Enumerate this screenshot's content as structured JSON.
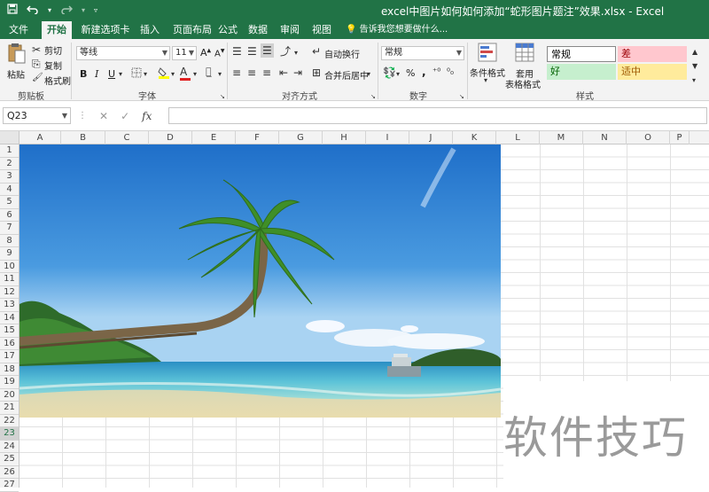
{
  "window": {
    "title": "excel中图片如何如何添加“蛇形图片题注”效果.xlsx - Excel"
  },
  "qat": {
    "save_icon": "save-icon",
    "undo_icon": "undo-icon",
    "redo_icon": "redo-icon"
  },
  "tabs": [
    {
      "label": "文件"
    },
    {
      "label": "开始"
    },
    {
      "label": "新建选项卡"
    },
    {
      "label": "插入"
    },
    {
      "label": "页面布局"
    },
    {
      "label": "公式"
    },
    {
      "label": "数据"
    },
    {
      "label": "审阅"
    },
    {
      "label": "视图"
    }
  ],
  "tell_me": "告诉我您想要做什么...",
  "ribbon": {
    "clipboard": {
      "label": "剪贴板",
      "paste": "粘贴",
      "cut": "剪切",
      "copy": "复制",
      "format_painter": "格式刷"
    },
    "font": {
      "label": "字体",
      "font_name": "等线",
      "font_size": "11",
      "bold": "B",
      "italic": "I",
      "underline": "U",
      "grow": "A",
      "shrink": "A",
      "font_color": "A",
      "font_color_value": "#e02020",
      "fill_color_value": "#ffff00"
    },
    "alignment": {
      "label": "对齐方式",
      "wrap": "自动换行",
      "merge": "合并后居中"
    },
    "number": {
      "label": "数字",
      "format": "常规",
      "percent": "%",
      "comma": ","
    },
    "styles": {
      "label": "样式",
      "conditional": "条件格式",
      "table_format_1": "套用",
      "table_format_2": "表格格式",
      "cell_styles": [
        {
          "label": "常规",
          "bg": "#ffffff",
          "color": "#000000"
        },
        {
          "label": "差",
          "bg": "#ffc7ce",
          "color": "#9c0006"
        },
        {
          "label": "好",
          "bg": "#c6efce",
          "color": "#006100"
        },
        {
          "label": "适中",
          "bg": "#ffeb9c",
          "color": "#9c5700"
        }
      ]
    }
  },
  "formula_bar": {
    "name_box": "Q23",
    "cancel": "✕",
    "enter": "✓",
    "fx": "fx",
    "value": ""
  },
  "grid": {
    "columns": [
      "A",
      "B",
      "C",
      "D",
      "E",
      "F",
      "G",
      "H",
      "I",
      "J",
      "K",
      "L",
      "M",
      "N",
      "O",
      "P"
    ],
    "rows": [
      "1",
      "2",
      "3",
      "4",
      "5",
      "6",
      "7",
      "8",
      "9",
      "10",
      "11",
      "12",
      "13",
      "14",
      "15",
      "16",
      "17",
      "18",
      "19",
      "20",
      "21",
      "22",
      "23",
      "24",
      "25",
      "26",
      "27"
    ],
    "selected_row": "23"
  },
  "watermark": "软件技巧",
  "colors": {
    "accent": "#217346"
  }
}
